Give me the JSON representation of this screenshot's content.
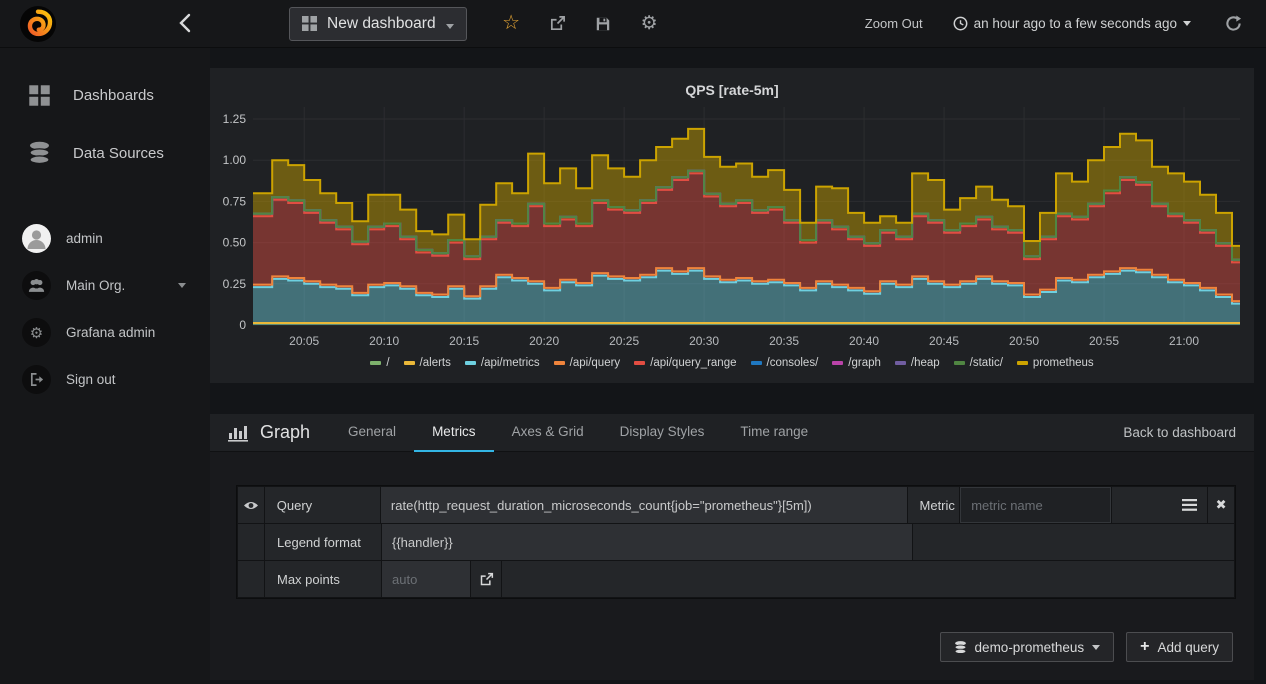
{
  "topbar": {
    "dashboard_title": "New dashboard",
    "zoom_out_label": "Zoom Out",
    "time_range_label": "an hour ago to a few seconds ago"
  },
  "sidebar": {
    "main": [
      {
        "label": "Dashboards"
      },
      {
        "label": "Data Sources"
      }
    ],
    "account": [
      {
        "label": "admin"
      },
      {
        "label": "Main Org."
      },
      {
        "label": "Grafana admin"
      },
      {
        "label": "Sign out"
      }
    ]
  },
  "editor": {
    "panel_type": "Graph",
    "tabs": [
      {
        "label": "General",
        "active": false
      },
      {
        "label": "Metrics",
        "active": true
      },
      {
        "label": "Axes & Grid",
        "active": false
      },
      {
        "label": "Display Styles",
        "active": false
      },
      {
        "label": "Time range",
        "active": false
      }
    ],
    "back_label": "Back to dashboard",
    "query_label": "Query",
    "query_value": "rate(http_request_duration_microseconds_count{job=\"prometheus\"}[5m])",
    "metric_label": "Metric",
    "metric_placeholder": "metric name",
    "legend_label": "Legend format",
    "legend_value": "{{handler}}",
    "maxpoints_label": "Max points",
    "maxpoints_placeholder": "auto",
    "datasource_label": "demo-prometheus",
    "add_query_label": "Add query"
  },
  "colors": {
    "accent_blue": "#33b5e5",
    "star_orange": "#e8a735"
  },
  "chart_data": {
    "type": "area",
    "stacked": true,
    "title": "QPS [rate-5m]",
    "ylabel": "",
    "xlabel": "",
    "ylim": [
      0,
      1.25
    ],
    "y_ticks": [
      0,
      0.25,
      0.5,
      0.75,
      1.0,
      1.25
    ],
    "y_tick_labels": [
      "0",
      "0.25",
      "0.50",
      "0.75",
      "1.00",
      "1.25"
    ],
    "x_tick_labels": [
      "20:05",
      "20:10",
      "20:15",
      "20:20",
      "20:25",
      "20:30",
      "20:35",
      "20:40",
      "20:45",
      "20:50",
      "20:55",
      "21:00"
    ],
    "x_tick_minutes": [
      5,
      10,
      15,
      20,
      25,
      30,
      35,
      40,
      45,
      50,
      55,
      60
    ],
    "minute_start": 2,
    "minute_step": 1,
    "note": "cumulative_top arrays are stacked-series upper boundaries (QPS) read from the graph, one value per minute from 20:02 to 21:03; sliver series are near-zero constants",
    "series": [
      {
        "name": "/",
        "color": "#7EB26D",
        "approx_value": 0.01
      },
      {
        "name": "/alerts",
        "color": "#EAB839",
        "approx_value": 0.012
      },
      {
        "name": "/api/metrics",
        "color": "#6ED0E0",
        "cumulative_top": [
          0.23,
          0.28,
          0.27,
          0.25,
          0.23,
          0.22,
          0.18,
          0.23,
          0.24,
          0.22,
          0.18,
          0.17,
          0.22,
          0.16,
          0.22,
          0.29,
          0.27,
          0.25,
          0.21,
          0.26,
          0.24,
          0.3,
          0.28,
          0.27,
          0.29,
          0.33,
          0.31,
          0.33,
          0.28,
          0.26,
          0.27,
          0.25,
          0.26,
          0.24,
          0.21,
          0.25,
          0.23,
          0.21,
          0.19,
          0.25,
          0.23,
          0.28,
          0.25,
          0.23,
          0.25,
          0.28,
          0.25,
          0.24,
          0.17,
          0.2,
          0.27,
          0.26,
          0.29,
          0.31,
          0.33,
          0.32,
          0.29,
          0.26,
          0.24,
          0.21,
          0.17,
          0.13
        ]
      },
      {
        "name": "/api/query",
        "color": "#EF843C",
        "approx_value": 0.015
      },
      {
        "name": "/api/query_range",
        "color": "#E24D42",
        "cumulative_top": [
          0.66,
          0.76,
          0.74,
          0.68,
          0.62,
          0.58,
          0.49,
          0.58,
          0.6,
          0.52,
          0.44,
          0.42,
          0.5,
          0.4,
          0.52,
          0.62,
          0.6,
          0.72,
          0.6,
          0.64,
          0.6,
          0.74,
          0.7,
          0.68,
          0.74,
          0.82,
          0.88,
          0.92,
          0.78,
          0.72,
          0.74,
          0.68,
          0.7,
          0.62,
          0.5,
          0.62,
          0.58,
          0.52,
          0.48,
          0.56,
          0.52,
          0.66,
          0.62,
          0.56,
          0.6,
          0.64,
          0.58,
          0.56,
          0.4,
          0.52,
          0.66,
          0.64,
          0.72,
          0.8,
          0.88,
          0.85,
          0.72,
          0.66,
          0.62,
          0.56,
          0.48,
          0.38
        ]
      },
      {
        "name": "/consoles/",
        "color": "#1F78C1",
        "approx_value": 0.005
      },
      {
        "name": "/graph",
        "color": "#BA43A9",
        "approx_value": 0.005
      },
      {
        "name": "/heap",
        "color": "#705DA0",
        "approx_value": 0.005
      },
      {
        "name": "/static/",
        "color": "#508642",
        "approx_value": 0.008
      },
      {
        "name": "prometheus",
        "color": "#CCA300",
        "cumulative_top": [
          0.8,
          1.0,
          0.97,
          0.88,
          0.8,
          0.74,
          0.63,
          0.79,
          0.79,
          0.7,
          0.57,
          0.55,
          0.67,
          0.52,
          0.73,
          0.86,
          0.8,
          1.04,
          0.86,
          0.95,
          0.83,
          1.03,
          0.95,
          0.9,
          1.0,
          1.08,
          1.13,
          1.19,
          1.02,
          0.96,
          0.98,
          0.9,
          0.94,
          0.82,
          0.62,
          0.84,
          0.83,
          0.68,
          0.62,
          0.66,
          0.62,
          0.92,
          0.88,
          0.7,
          0.77,
          0.84,
          0.76,
          0.72,
          0.51,
          0.68,
          0.92,
          0.87,
          1.0,
          1.08,
          1.16,
          1.12,
          0.96,
          0.92,
          0.87,
          0.79,
          0.68,
          0.48
        ]
      }
    ]
  }
}
